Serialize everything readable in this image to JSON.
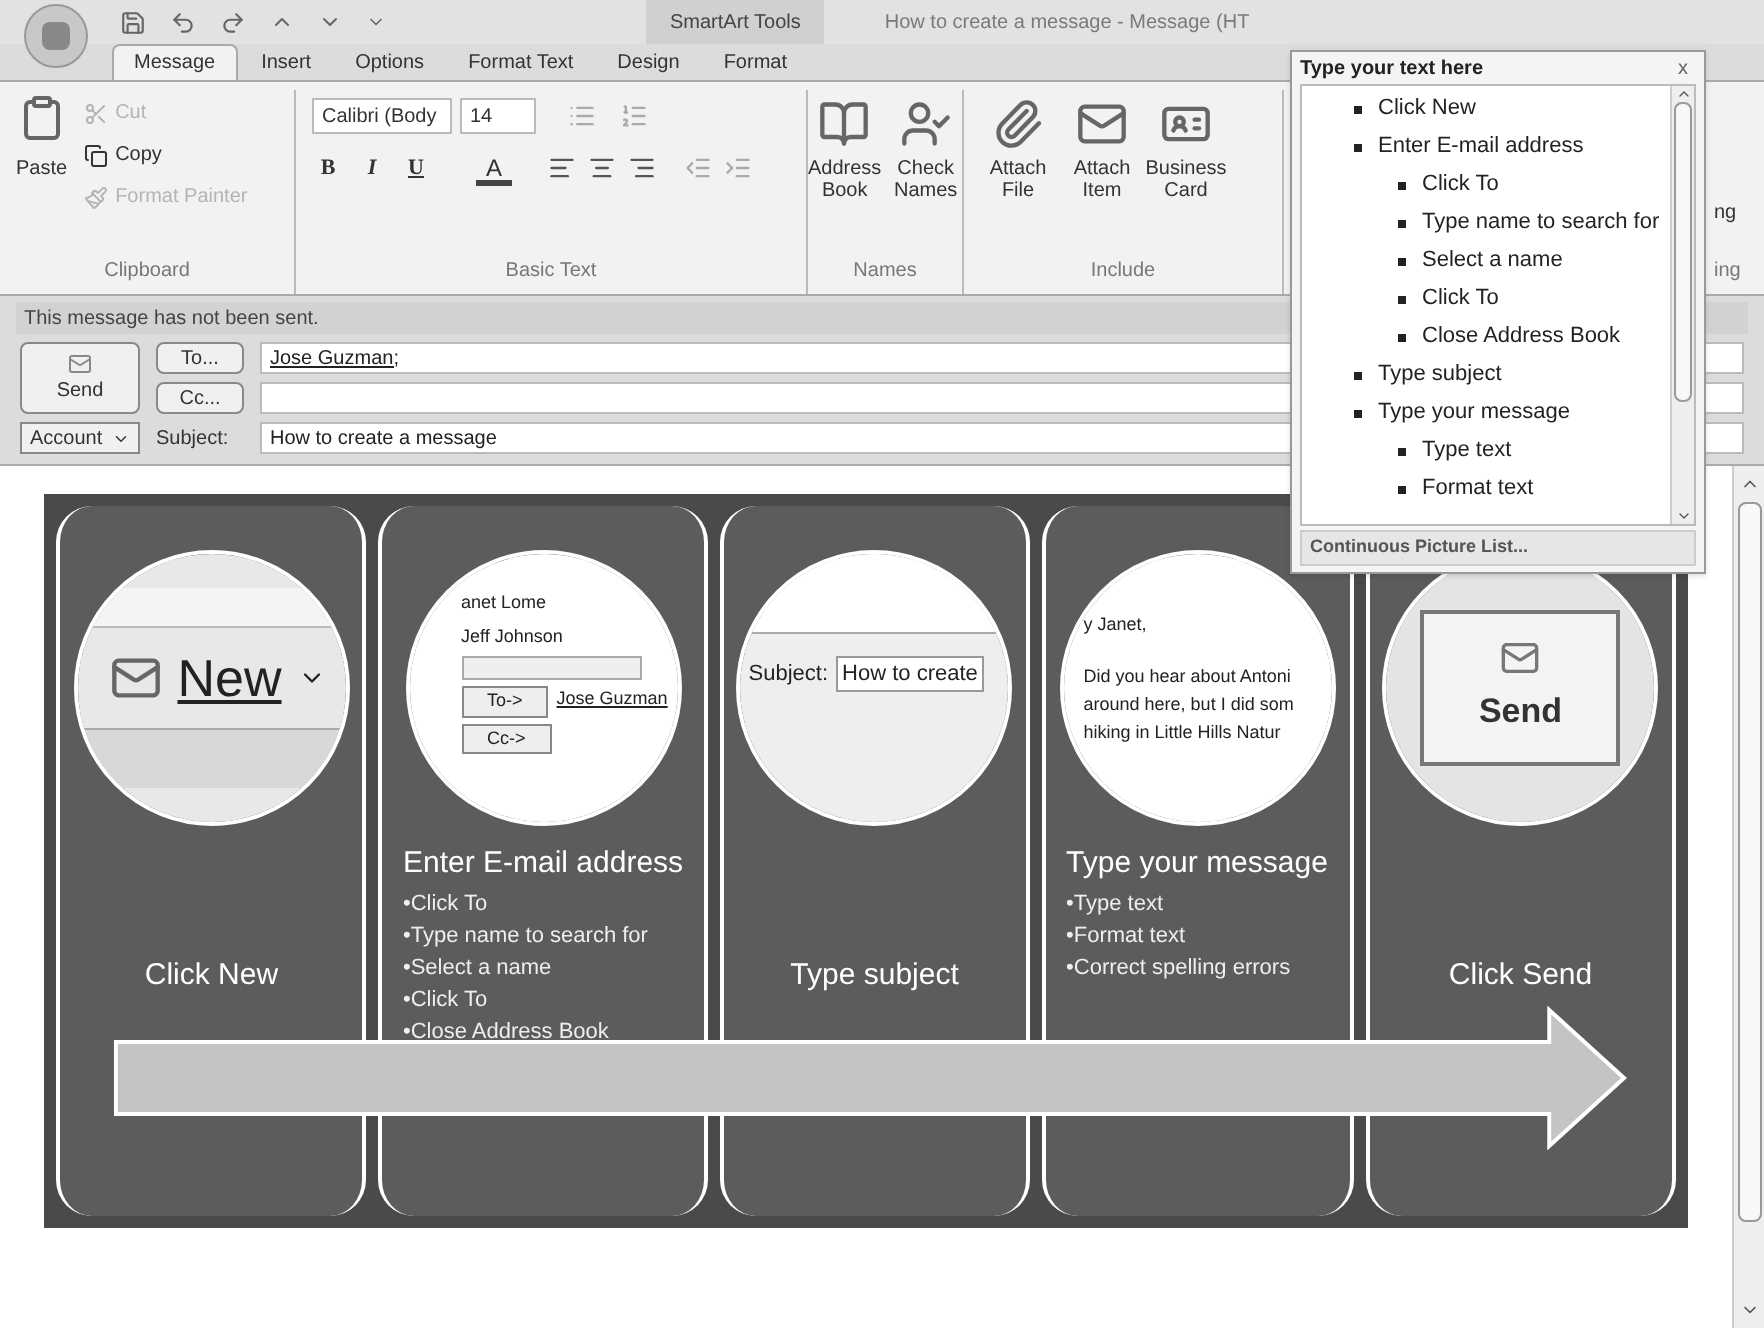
{
  "title_bar": {
    "context_tab": "SmartArt Tools",
    "title": "How to create a message - Message (HT"
  },
  "tabs": [
    {
      "label": "Message",
      "selected": true
    },
    {
      "label": "Insert",
      "selected": false
    },
    {
      "label": "Options",
      "selected": false
    },
    {
      "label": "Format Text",
      "selected": false
    },
    {
      "label": "Design",
      "selected": false
    },
    {
      "label": "Format",
      "selected": false
    }
  ],
  "ribbon": {
    "clipboard": {
      "label": "Clipboard",
      "paste": "Paste",
      "small": [
        {
          "label": "Cut",
          "disabled": true
        },
        {
          "label": "Copy",
          "disabled": false
        },
        {
          "label": "Format Painter",
          "disabled": true
        }
      ]
    },
    "basic_text": {
      "label": "Basic Text",
      "font": "Calibri (Body",
      "size": "14",
      "styles": [
        "B",
        "I",
        "U"
      ],
      "font_color": "A"
    },
    "names": {
      "label": "Names",
      "buttons": [
        "Address Book",
        "Check Names"
      ]
    },
    "include": {
      "label": "Include",
      "buttons": [
        "Attach File",
        "Attach Item",
        "Business Card"
      ]
    },
    "partial": {
      "button": "ng",
      "group": "ing"
    }
  },
  "info_bar": "This message has not been sent.",
  "header": {
    "send": "Send",
    "to_button": "To...",
    "cc_button": "Cc...",
    "to_value": "Jose Guzman;",
    "account": "Account",
    "subject_label": "Subject:",
    "subject": "How to create a message"
  },
  "slide": {
    "panels": [
      {
        "title": "Click New",
        "picture": {
          "kind": "new",
          "texts": [
            "New"
          ]
        }
      },
      {
        "title": "Enter E-mail address",
        "bullets": [
          "•Click To",
          "•Type name to search for",
          "•Select a name",
          "•Click To",
          "•Close Address Book"
        ],
        "picture": {
          "kind": "address",
          "texts": [
            "anet Lome",
            "Jeff Johnson",
            "To->",
            "Jose Guzman",
            "Cc->"
          ]
        }
      },
      {
        "title": "Type subject",
        "picture": {
          "kind": "subject",
          "texts": [
            "Subject:",
            "How to create"
          ]
        }
      },
      {
        "title": "Type your message",
        "bullets": [
          "•Type text",
          "•Format text",
          "•Correct spelling errors"
        ],
        "picture": {
          "kind": "letter",
          "texts": [
            "y Janet,",
            "Did you hear about Antoni",
            "around here, but I did som",
            "hiking in Little Hills Natur"
          ]
        }
      },
      {
        "title": "Click Send",
        "picture": {
          "kind": "send",
          "texts": [
            "Send"
          ]
        }
      }
    ]
  },
  "text_pane": {
    "title": "Type your text here",
    "close": "x",
    "items": [
      {
        "text": "Click New"
      },
      {
        "text": "Enter E-mail address",
        "children": [
          {
            "text": "Click To"
          },
          {
            "text": "Type name to search for"
          },
          {
            "text": "Select a name"
          },
          {
            "text": "Click To"
          },
          {
            "text": "Close Address Book"
          }
        ]
      },
      {
        "text": "Type subject"
      },
      {
        "text": "Type your message",
        "children": [
          {
            "text": "Type text"
          },
          {
            "text": "Format text"
          }
        ]
      }
    ],
    "footer": "Continuous Picture List..."
  }
}
